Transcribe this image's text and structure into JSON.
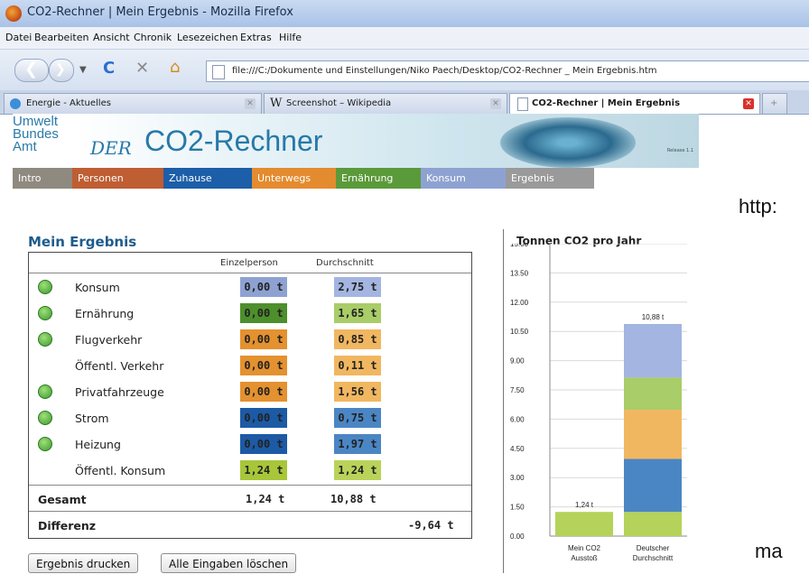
{
  "window": {
    "title": "CO2-Rechner | Mein Ergebnis - Mozilla Firefox"
  },
  "menu": [
    "Datei",
    "Bearbeiten",
    "Ansicht",
    "Chronik",
    "Lesezeichen",
    "Extras",
    "Hilfe"
  ],
  "urlbar": {
    "value": "file:///C:/Dokumente und Einstellungen/Niko Paech/Desktop/CO2-Rechner _ Mein Ergebnis.htm"
  },
  "tabs": [
    {
      "label": "Energie - Aktuelles",
      "active": false
    },
    {
      "label": "Screenshot – Wikipedia",
      "active": false
    },
    {
      "label": "CO2-Rechner | Mein Ergebnis",
      "active": true
    }
  ],
  "header": {
    "logo_lines": [
      "Umwelt",
      "Bundes",
      "Amt"
    ],
    "banner_der": "DER",
    "banner_name": "CO2-Rechner",
    "release": "Release 1.1"
  },
  "sections": [
    {
      "label": "Intro",
      "color": "#8f8a80"
    },
    {
      "label": "Personen",
      "color": "#bf5e33"
    },
    {
      "label": "Zuhause",
      "color": "#1c5ea8"
    },
    {
      "label": "Unterwegs",
      "color": "#e48b2f"
    },
    {
      "label": "Ernährung",
      "color": "#5a9a3a"
    },
    {
      "label": "Konsum",
      "color": "#8ea2d2"
    },
    {
      "label": "Ergebnis",
      "color": "#9a9a9a"
    }
  ],
  "side": {
    "right_top": "http:",
    "right_bottom": "ma"
  },
  "result": {
    "title": "Mein Ergebnis",
    "col_person": "Einzelperson",
    "col_avg": "Durchschnitt",
    "rows": [
      {
        "label": "Konsum",
        "smiley": true,
        "person": "0,00 t",
        "avg": "2,75 t",
        "person_color": "#8ea2d2",
        "avg_color": "#a3b5e0"
      },
      {
        "label": "Ernährung",
        "smiley": true,
        "person": "0,00 t",
        "avg": "1,65 t",
        "person_color": "#4d8f2c",
        "avg_color": "#a9cd68"
      },
      {
        "label": "Flugverkehr",
        "smiley": true,
        "person": "0,00 t",
        "avg": "0,85 t",
        "person_color": "#e4912f",
        "avg_color": "#f1b760"
      },
      {
        "label": "Öffentl. Verkehr",
        "smiley": false,
        "person": "0,00 t",
        "avg": "0,11 t",
        "person_color": "#e4912f",
        "avg_color": "#f1b760"
      },
      {
        "label": "Privatfahrzeuge",
        "smiley": true,
        "person": "0,00 t",
        "avg": "1,56 t",
        "person_color": "#e4912f",
        "avg_color": "#f1b760"
      },
      {
        "label": "Strom",
        "smiley": true,
        "person": "0,00 t",
        "avg": "0,75 t",
        "person_color": "#1d5aa6",
        "avg_color": "#4b86c4"
      },
      {
        "label": "Heizung",
        "smiley": true,
        "person": "0,00 t",
        "avg": "1,97 t",
        "person_color": "#1d5aa6",
        "avg_color": "#4b86c4"
      },
      {
        "label": "Öffentl. Konsum",
        "smiley": false,
        "person": "1,24 t",
        "avg": "1,24 t",
        "person_color": "#a8c63a",
        "avg_color": "#b9d35a"
      }
    ],
    "total_label": "Gesamt",
    "total_person": "1,24 t",
    "total_avg": "10,88 t",
    "diff_label": "Differenz",
    "diff_value": "-9,64 t"
  },
  "buttons": {
    "print": "Ergebnis drucken",
    "clear": "Alle Eingaben löschen"
  },
  "chart_data": {
    "type": "bar",
    "stacked": true,
    "title": "Tonnen CO2 pro Jahr",
    "ylim": [
      0,
      15
    ],
    "yticks": [
      "0.00",
      "1.50",
      "3.00",
      "4.50",
      "6.00",
      "7.50",
      "9.00",
      "10.50",
      "12.00",
      "13.50",
      "15.00"
    ],
    "categories": [
      "Mein CO2 Ausstoß",
      "Deutscher Durchschnitt"
    ],
    "category_labels": [
      [
        "Mein CO2",
        "Ausstoß"
      ],
      [
        "Deutscher",
        "Durchschnitt"
      ]
    ],
    "series": [
      {
        "values": [
          1.24,
          1.24
        ],
        "color": "#b5d35a"
      },
      {
        "values": [
          0,
          2.72
        ],
        "color": "#4b86c4"
      },
      {
        "values": [
          0,
          2.52
        ],
        "color": "#f1b760"
      },
      {
        "values": [
          0,
          1.65
        ],
        "color": "#a9cd68"
      },
      {
        "values": [
          0,
          2.75
        ],
        "color": "#a3b5e0"
      }
    ],
    "bar_labels": [
      "1,24 t",
      "10,88 t"
    ]
  }
}
